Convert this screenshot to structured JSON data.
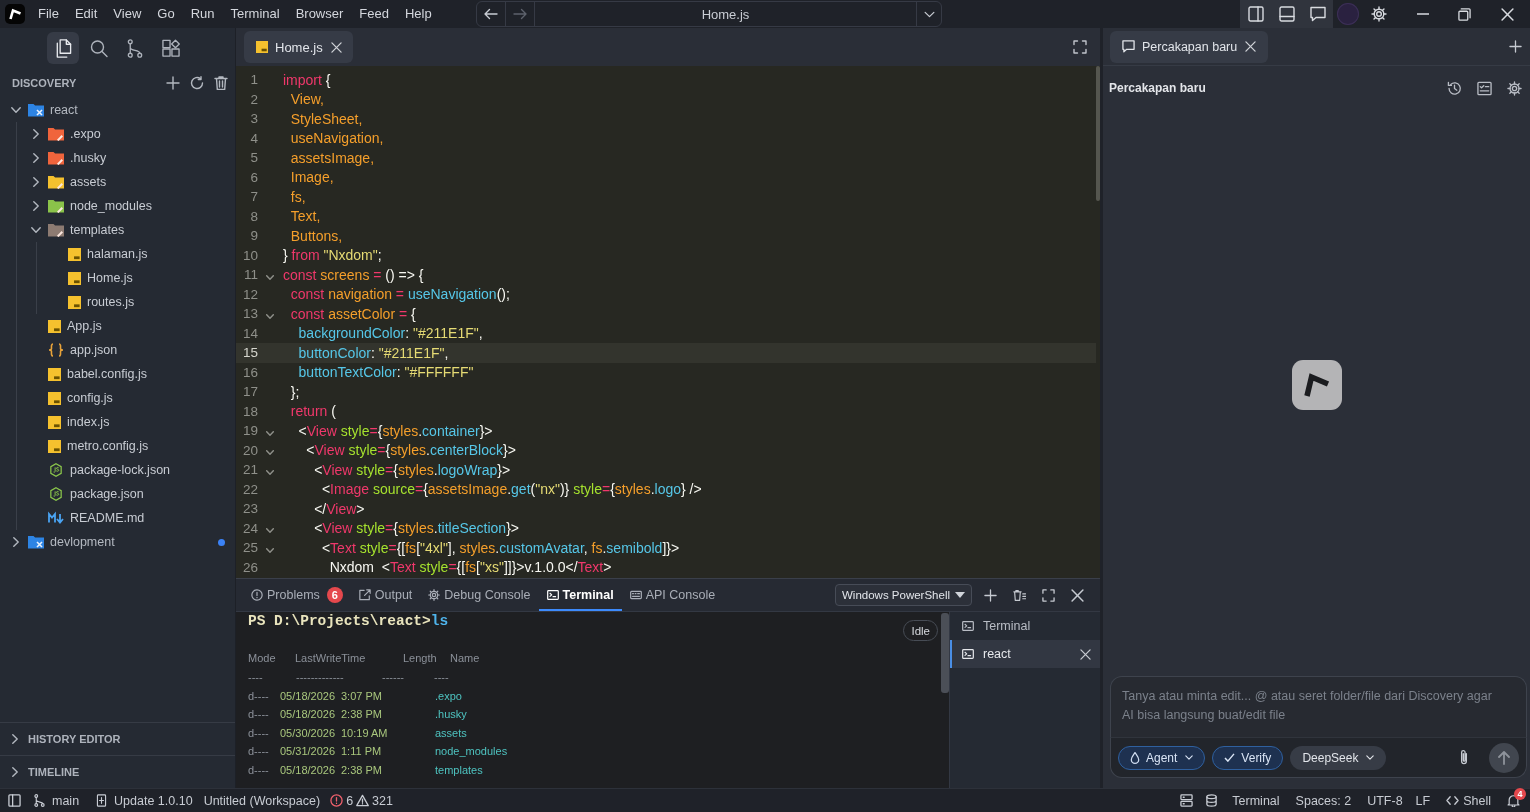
{
  "title_bar": {
    "menu": [
      "File",
      "Edit",
      "View",
      "Go",
      "Run",
      "Terminal",
      "Browser",
      "Feed",
      "Help"
    ],
    "nav_buttons": [
      {
        "kind": "back",
        "disabled": false
      },
      {
        "kind": "forward",
        "disabled": true
      }
    ],
    "command_center": "Home.js"
  },
  "sidebar": {
    "activity_bar": [
      {
        "kind": "explorer",
        "selected": true
      },
      {
        "kind": "search",
        "selected": false
      },
      {
        "kind": "source_control",
        "selected": false
      },
      {
        "kind": "extensions",
        "selected": false
      }
    ],
    "title": "DISCOVERY",
    "tree": [
      {
        "label": "react",
        "kind": "workspace",
        "expanded": true,
        "modified": false,
        "children": [
          {
            "label": ".expo",
            "kind": "folder",
            "color": "#f0643c",
            "expanded": false
          },
          {
            "label": ".husky",
            "kind": "folder",
            "color": "#f0643c",
            "expanded": false
          },
          {
            "label": "assets",
            "kind": "folder",
            "color": "#f5c12e",
            "expanded": false
          },
          {
            "label": "node_modules",
            "kind": "folder",
            "color": "#8bc34a",
            "expanded": false
          },
          {
            "label": "templates",
            "kind": "folder",
            "color": "#8d7b72",
            "expanded": true,
            "children": [
              {
                "label": "halaman.js",
                "kind": "js"
              },
              {
                "label": "Home.js",
                "kind": "js"
              },
              {
                "label": "routes.js",
                "kind": "js"
              }
            ]
          },
          {
            "label": "App.js",
            "kind": "js"
          },
          {
            "label": "app.json",
            "kind": "json"
          },
          {
            "label": "babel.config.js",
            "kind": "js"
          },
          {
            "label": "config.js",
            "kind": "js"
          },
          {
            "label": "index.js",
            "kind": "js"
          },
          {
            "label": "metro.config.js",
            "kind": "js"
          },
          {
            "label": "package-lock.json",
            "kind": "node"
          },
          {
            "label": "package.json",
            "kind": "node"
          },
          {
            "label": "README.md",
            "kind": "markdown"
          }
        ]
      },
      {
        "label": "devlopment",
        "kind": "workspace",
        "expanded": false,
        "modified": true
      }
    ],
    "sections": [
      {
        "title": "HISTORY EDITOR",
        "expanded": false
      },
      {
        "title": "TIMELINE",
        "expanded": false
      }
    ]
  },
  "editor": {
    "tabs": [
      {
        "label": "Home.js",
        "kind": "js",
        "selected": true
      }
    ],
    "lines": [
      {
        "number": "1",
        "foldable": false,
        "current": false,
        "tokens": [
          {
            "kind": "keyword",
            "text": "import"
          },
          {
            "kind": "plain",
            "text": " {"
          }
        ]
      },
      {
        "number": "2",
        "foldable": false,
        "current": false,
        "tokens": [
          {
            "kind": "name",
            "text": "  View,"
          }
        ]
      },
      {
        "number": "3",
        "foldable": false,
        "current": false,
        "tokens": [
          {
            "kind": "name",
            "text": "  StyleSheet,"
          }
        ]
      },
      {
        "number": "4",
        "foldable": false,
        "current": false,
        "tokens": [
          {
            "kind": "name",
            "text": "  useNavigation,"
          }
        ]
      },
      {
        "number": "5",
        "foldable": false,
        "current": false,
        "tokens": [
          {
            "kind": "name",
            "text": "  assetsImage,"
          }
        ]
      },
      {
        "number": "6",
        "foldable": false,
        "current": false,
        "tokens": [
          {
            "kind": "name",
            "text": "  Image,"
          }
        ]
      },
      {
        "number": "7",
        "foldable": false,
        "current": false,
        "tokens": [
          {
            "kind": "name",
            "text": "  fs,"
          }
        ]
      },
      {
        "number": "8",
        "foldable": false,
        "current": false,
        "tokens": [
          {
            "kind": "name",
            "text": "  Text,"
          }
        ]
      },
      {
        "number": "9",
        "foldable": false,
        "current": false,
        "tokens": [
          {
            "kind": "name",
            "text": "  Buttons,"
          }
        ]
      },
      {
        "number": "10",
        "foldable": false,
        "current": false,
        "tokens": [
          {
            "kind": "plain",
            "text": "} "
          },
          {
            "kind": "keyword",
            "text": "from"
          },
          {
            "kind": "string",
            "text": " \"Nxdom\""
          },
          {
            "kind": "plain",
            "text": ";"
          }
        ]
      },
      {
        "number": "11",
        "foldable": true,
        "current": false,
        "tokens": [
          {
            "kind": "keyword",
            "text": "const"
          },
          {
            "kind": "name",
            "text": " screens"
          },
          {
            "kind": "keyword",
            "text": " ="
          },
          {
            "kind": "plain",
            "text": " () => {"
          }
        ]
      },
      {
        "number": "12",
        "foldable": false,
        "current": false,
        "tokens": [
          {
            "kind": "keyword",
            "text": "  const"
          },
          {
            "kind": "name",
            "text": " navigation"
          },
          {
            "kind": "keyword",
            "text": " ="
          },
          {
            "kind": "function",
            "text": " useNavigation"
          },
          {
            "kind": "plain",
            "text": "();"
          }
        ]
      },
      {
        "number": "13",
        "foldable": true,
        "current": false,
        "tokens": [
          {
            "kind": "keyword",
            "text": "  const"
          },
          {
            "kind": "name",
            "text": " assetColor"
          },
          {
            "kind": "keyword",
            "text": " ="
          },
          {
            "kind": "plain",
            "text": " {"
          }
        ]
      },
      {
        "number": "14",
        "foldable": false,
        "current": false,
        "tokens": [
          {
            "kind": "function",
            "text": "    backgroundColor"
          },
          {
            "kind": "plain",
            "text": ": "
          },
          {
            "kind": "string",
            "text": "\"#211E1F\""
          },
          {
            "kind": "plain",
            "text": ","
          }
        ]
      },
      {
        "number": "15",
        "foldable": false,
        "current": true,
        "tokens": [
          {
            "kind": "function",
            "text": "    buttonColor"
          },
          {
            "kind": "plain",
            "text": ": "
          },
          {
            "kind": "string",
            "text": "\"#211E1F\""
          },
          {
            "kind": "plain",
            "text": ","
          }
        ]
      },
      {
        "number": "16",
        "foldable": false,
        "current": false,
        "tokens": [
          {
            "kind": "function",
            "text": "    buttonTextColor"
          },
          {
            "kind": "plain",
            "text": ": "
          },
          {
            "kind": "string",
            "text": "\"#FFFFFF\""
          }
        ]
      },
      {
        "number": "17",
        "foldable": false,
        "current": false,
        "tokens": [
          {
            "kind": "plain",
            "text": "  };"
          }
        ]
      },
      {
        "number": "18",
        "foldable": false,
        "current": false,
        "tokens": [
          {
            "kind": "keyword",
            "text": "  return"
          },
          {
            "kind": "plain",
            "text": " ("
          }
        ]
      },
      {
        "number": "19",
        "foldable": true,
        "current": false,
        "tokens": [
          {
            "kind": "plain",
            "text": "    <"
          },
          {
            "kind": "keyword",
            "text": "View"
          },
          {
            "kind": "attribute",
            "text": " style"
          },
          {
            "kind": "keyword",
            "text": "="
          },
          {
            "kind": "plain",
            "text": "{"
          },
          {
            "kind": "name",
            "text": "styles"
          },
          {
            "kind": "plain",
            "text": "."
          },
          {
            "kind": "function",
            "text": "container"
          },
          {
            "kind": "plain",
            "text": "}>"
          }
        ]
      },
      {
        "number": "20",
        "foldable": true,
        "current": false,
        "tokens": [
          {
            "kind": "plain",
            "text": "      <"
          },
          {
            "kind": "keyword",
            "text": "View"
          },
          {
            "kind": "attribute",
            "text": " style"
          },
          {
            "kind": "keyword",
            "text": "="
          },
          {
            "kind": "plain",
            "text": "{"
          },
          {
            "kind": "name",
            "text": "styles"
          },
          {
            "kind": "plain",
            "text": "."
          },
          {
            "kind": "function",
            "text": "centerBlock"
          },
          {
            "kind": "plain",
            "text": "}>"
          }
        ]
      },
      {
        "number": "21",
        "foldable": true,
        "current": false,
        "tokens": [
          {
            "kind": "plain",
            "text": "        <"
          },
          {
            "kind": "keyword",
            "text": "View"
          },
          {
            "kind": "attribute",
            "text": " style"
          },
          {
            "kind": "keyword",
            "text": "="
          },
          {
            "kind": "plain",
            "text": "{"
          },
          {
            "kind": "name",
            "text": "styles"
          },
          {
            "kind": "plain",
            "text": "."
          },
          {
            "kind": "function",
            "text": "logoWrap"
          },
          {
            "kind": "plain",
            "text": "}>"
          }
        ]
      },
      {
        "number": "22",
        "foldable": false,
        "current": false,
        "tokens": [
          {
            "kind": "plain",
            "text": "          <"
          },
          {
            "kind": "keyword",
            "text": "Image"
          },
          {
            "kind": "attribute",
            "text": " source"
          },
          {
            "kind": "keyword",
            "text": "="
          },
          {
            "kind": "plain",
            "text": "{"
          },
          {
            "kind": "name",
            "text": "assetsImage"
          },
          {
            "kind": "plain",
            "text": "."
          },
          {
            "kind": "function",
            "text": "get"
          },
          {
            "kind": "plain",
            "text": "("
          },
          {
            "kind": "string",
            "text": "\"nx\""
          },
          {
            "kind": "plain",
            "text": ")} "
          },
          {
            "kind": "attribute",
            "text": "style"
          },
          {
            "kind": "keyword",
            "text": "="
          },
          {
            "kind": "plain",
            "text": "{"
          },
          {
            "kind": "name",
            "text": "styles"
          },
          {
            "kind": "plain",
            "text": "."
          },
          {
            "kind": "function",
            "text": "logo"
          },
          {
            "kind": "plain",
            "text": "} />"
          }
        ]
      },
      {
        "number": "23",
        "foldable": false,
        "current": false,
        "tokens": [
          {
            "kind": "plain",
            "text": "        </"
          },
          {
            "kind": "keyword",
            "text": "View"
          },
          {
            "kind": "plain",
            "text": ">"
          }
        ]
      },
      {
        "number": "24",
        "foldable": true,
        "current": false,
        "tokens": [
          {
            "kind": "plain",
            "text": "        <"
          },
          {
            "kind": "keyword",
            "text": "View"
          },
          {
            "kind": "attribute",
            "text": " style"
          },
          {
            "kind": "keyword",
            "text": "="
          },
          {
            "kind": "plain",
            "text": "{"
          },
          {
            "kind": "name",
            "text": "styles"
          },
          {
            "kind": "plain",
            "text": "."
          },
          {
            "kind": "function",
            "text": "titleSection"
          },
          {
            "kind": "plain",
            "text": "}>"
          }
        ]
      },
      {
        "number": "25",
        "foldable": true,
        "current": false,
        "tokens": [
          {
            "kind": "plain",
            "text": "          <"
          },
          {
            "kind": "keyword",
            "text": "Text"
          },
          {
            "kind": "attribute",
            "text": " style"
          },
          {
            "kind": "keyword",
            "text": "="
          },
          {
            "kind": "plain",
            "text": "{["
          },
          {
            "kind": "name",
            "text": "fs"
          },
          {
            "kind": "plain",
            "text": "["
          },
          {
            "kind": "string",
            "text": "\"4xl\""
          },
          {
            "kind": "plain",
            "text": "], "
          },
          {
            "kind": "name",
            "text": "styles"
          },
          {
            "kind": "plain",
            "text": "."
          },
          {
            "kind": "function",
            "text": "customAvatar"
          },
          {
            "kind": "plain",
            "text": ", "
          },
          {
            "kind": "name",
            "text": "fs"
          },
          {
            "kind": "plain",
            "text": "."
          },
          {
            "kind": "function",
            "text": "semibold"
          },
          {
            "kind": "plain",
            "text": "]}>"
          }
        ]
      },
      {
        "number": "26",
        "foldable": false,
        "current": false,
        "tokens": [
          {
            "kind": "plain",
            "text": "            Nxdom  <"
          },
          {
            "kind": "keyword",
            "text": "Text"
          },
          {
            "kind": "attribute",
            "text": " style"
          },
          {
            "kind": "keyword",
            "text": "="
          },
          {
            "kind": "plain",
            "text": "{["
          },
          {
            "kind": "name",
            "text": "fs"
          },
          {
            "kind": "plain",
            "text": "["
          },
          {
            "kind": "string",
            "text": "\"xs\""
          },
          {
            "kind": "plain",
            "text": "]]}>v.1.0.0</"
          },
          {
            "kind": "keyword",
            "text": "Text"
          },
          {
            "kind": "plain",
            "text": ">"
          }
        ]
      }
    ]
  },
  "panel": {
    "tabs": [
      {
        "kind": "problems",
        "label": "Problems",
        "badge": "6",
        "selected": false
      },
      {
        "kind": "output",
        "label": "Output",
        "selected": false
      },
      {
        "kind": "debug",
        "label": "Debug Console",
        "selected": false
      },
      {
        "kind": "terminal",
        "label": "Terminal",
        "selected": true
      },
      {
        "kind": "api",
        "label": "API Console",
        "selected": false
      }
    ],
    "shell": "Windows PowerShell",
    "terminal": {
      "prompt": "PS D:\\Projects\\react>",
      "command": "ls",
      "status": "Idle",
      "columns": [
        "Mode",
        "LastWriteTime",
        "Length",
        "Name"
      ],
      "rules": [
        "----",
        "-------------",
        "------",
        "----"
      ],
      "entries": [
        {
          "mode": "d----",
          "date": "05/18/2026",
          "time": "3:07 PM",
          "name": ".expo"
        },
        {
          "mode": "d----",
          "date": "05/18/2026",
          "time": "2:38 PM",
          "name": ".husky"
        },
        {
          "mode": "d----",
          "date": "05/30/2026",
          "time": "10:19 AM",
          "name": "assets"
        },
        {
          "mode": "d----",
          "date": "05/31/2026",
          "time": "1:11 PM",
          "name": "node_modules"
        },
        {
          "mode": "d----",
          "date": "05/18/2026",
          "time": "2:38 PM",
          "name": "templates"
        }
      ]
    },
    "sessions": [
      {
        "label": "Terminal",
        "selected": false
      },
      {
        "label": "react",
        "selected": true
      }
    ]
  },
  "chat": {
    "tabs": [
      {
        "label": "Percakapan baru",
        "selected": true
      }
    ],
    "title": "Percakapan baru",
    "input": {
      "placeholder": "Tanya atau minta edit... @ atau seret folder/file dari Discovery agar AI bisa langsung buat/edit file"
    },
    "controls": [
      {
        "kind": "mode",
        "label": "Agent",
        "active": true
      },
      {
        "kind": "toggle",
        "label": "Verify",
        "active": true
      },
      {
        "kind": "model",
        "label": "DeepSeek",
        "active": false
      }
    ]
  },
  "status_bar": {
    "branch": "main",
    "update": "Update 1.0.10",
    "workspace": "Untitled (Workspace)",
    "errors": "6",
    "warnings": "321",
    "terminal": "Terminal",
    "indentation": "Spaces: 2",
    "encoding": "UTF-8",
    "line_ending": "LF",
    "language": "Shell",
    "notifications": "4"
  }
}
